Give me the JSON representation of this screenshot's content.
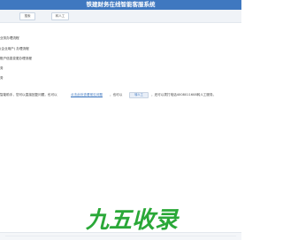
{
  "header": {
    "title": "铁建财务在线智能客服系统"
  },
  "toolbar": {
    "btn1_label": "搜索",
    "btn2_label": "转人工"
  },
  "menu": {
    "items": [
      {
        "label": "业务办理流程"
      },
      {
        "label": "(企业用户) 办理流程"
      },
      {
        "label": "账户信息变更办理流程"
      },
      {
        "label": "务"
      },
      {
        "label": "务"
      }
    ]
  },
  "help": {
    "seg1": "智能助手，您可以直接回复问题，也可以",
    "link": "点击此处查看常见问题",
    "seg2": "，也可以",
    "button": "转人工",
    "seg3": "，还可以拨打电话4008011608转人工服务。"
  },
  "watermark": {
    "text": "九五收录"
  },
  "colors": {
    "header_bg": "#3f78c0",
    "watermark": "#2aa838"
  }
}
